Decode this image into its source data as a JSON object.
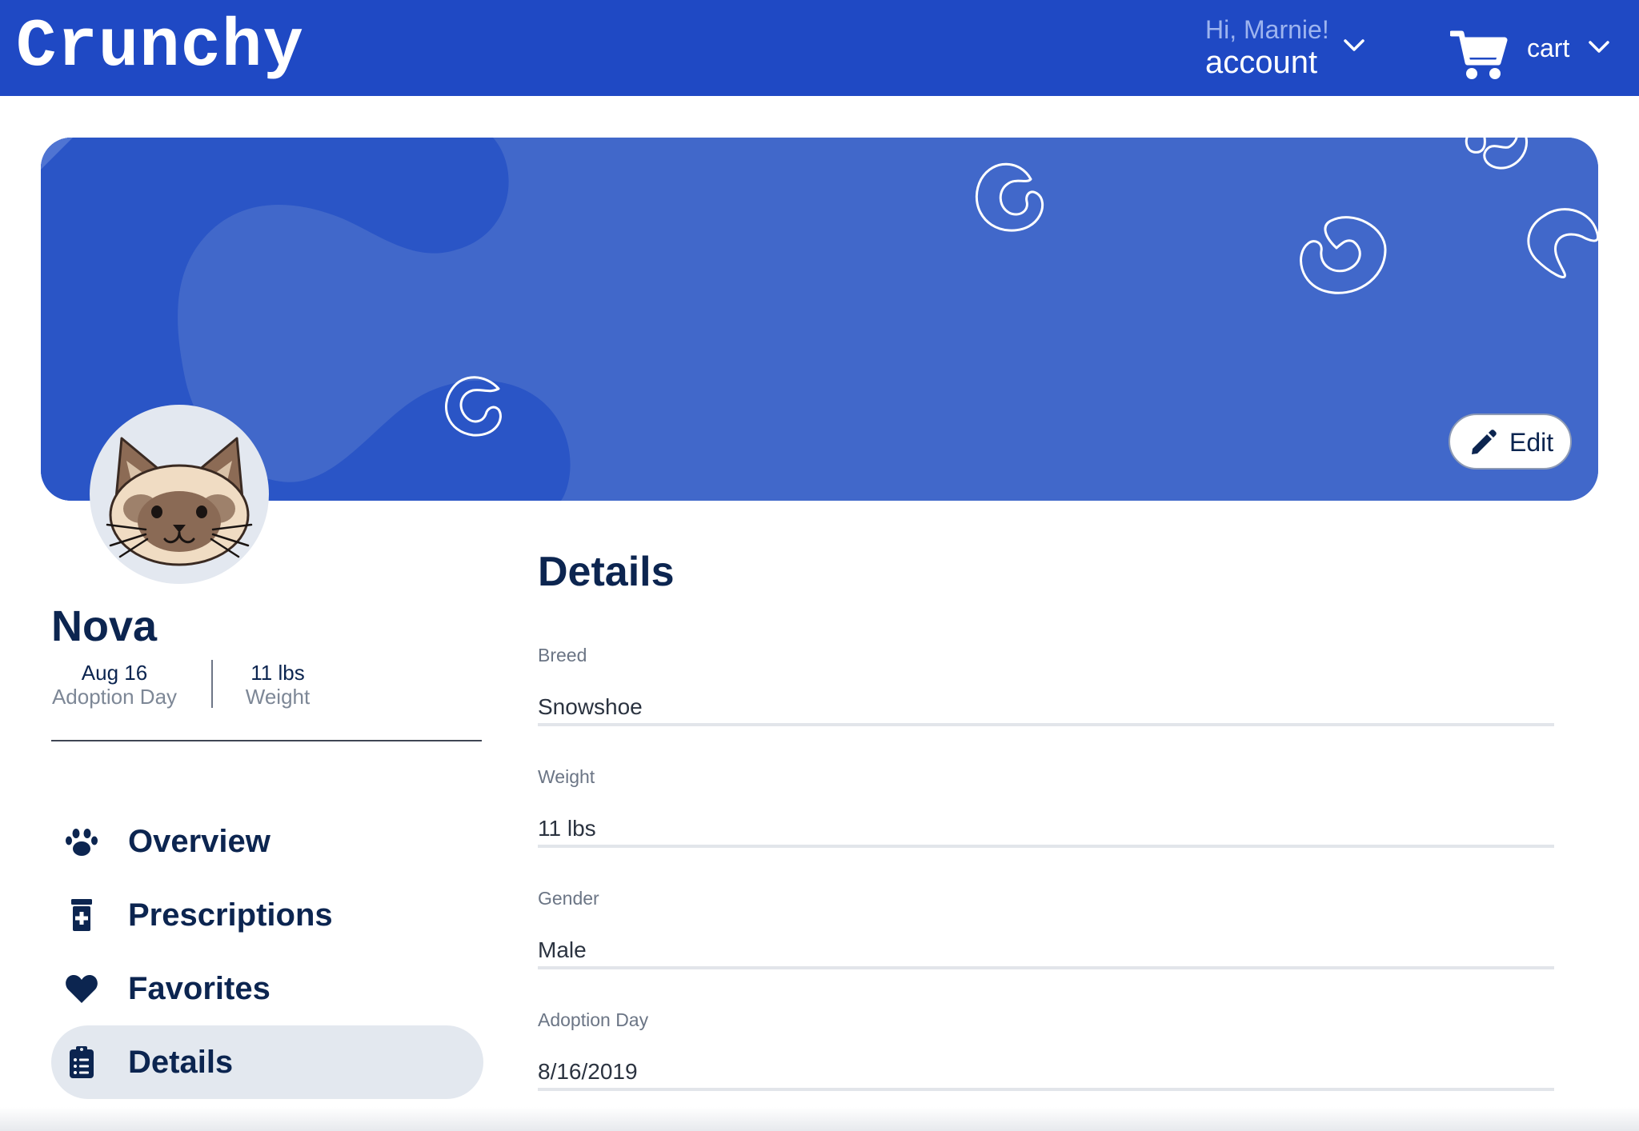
{
  "header": {
    "logo": "Crunchy",
    "account_greeting": "Hi, Marnie!",
    "account_label": "account",
    "cart_label": "cart"
  },
  "profile": {
    "name": "Nova",
    "adoption_value": "Aug 16",
    "adoption_label": "Adoption Day",
    "weight_value": "11 lbs",
    "weight_label": "Weight",
    "edit_label": "Edit"
  },
  "nav": {
    "items": [
      {
        "label": "Overview",
        "icon": "paw-icon"
      },
      {
        "label": "Prescriptions",
        "icon": "prescription-bottle-icon"
      },
      {
        "label": "Favorites",
        "icon": "heart-icon"
      },
      {
        "label": "Details",
        "icon": "clipboard-list-icon",
        "active": true
      }
    ]
  },
  "details": {
    "title": "Details",
    "fields": [
      {
        "label": "Breed",
        "value": "Snowshoe"
      },
      {
        "label": "Weight",
        "value": "11 lbs"
      },
      {
        "label": "Gender",
        "value": "Male"
      },
      {
        "label": "Adoption Day",
        "value": "8/16/2019"
      }
    ]
  },
  "colors": {
    "header_blue": "#1f49c4",
    "banner_blue": "#4168ca",
    "banner_blob": "#2a55c6",
    "navy_text": "#0c2550",
    "active_nav_bg": "#e3e8ef"
  }
}
